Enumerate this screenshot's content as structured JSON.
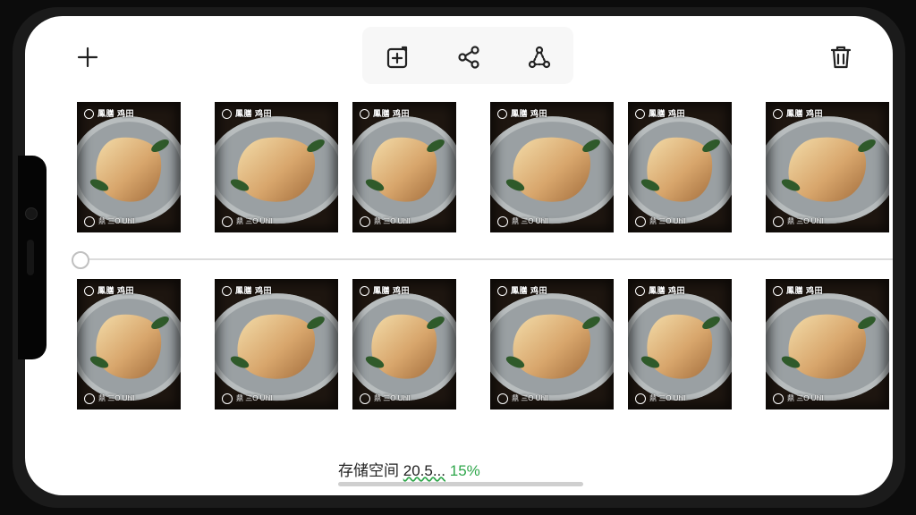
{
  "toolbar": {
    "add_icon": "plus-icon",
    "add_to_album_icon": "add-photo-icon",
    "share_icon": "share-icon",
    "scan_icon": "scan-icon",
    "delete_icon": "trash-icon"
  },
  "rows": [
    {
      "items": [
        {
          "top_caption": "鳳膳 鸡田",
          "bottom_caption": "鼎 三O Uhll"
        },
        {
          "top_caption": "鳳膳 鸡田",
          "bottom_caption": "鼎 三O Uhll"
        },
        {
          "top_caption": "鳳膳 鸡田",
          "bottom_caption": "鼎 三O Uhll"
        },
        {
          "top_caption": "鳳膳 鸡田",
          "bottom_caption": "鼎 三O Uhll"
        },
        {
          "top_caption": "鳳膳 鸡田",
          "bottom_caption": "鼎 三O Uhll"
        },
        {
          "top_caption": "鳳膳 鸡田",
          "bottom_caption": "鼎 三O Uhll"
        }
      ]
    },
    {
      "items": [
        {
          "top_caption": "鳳膳 鸡田",
          "bottom_caption": "鼎 三O Uhll"
        },
        {
          "top_caption": "鳳膳 鸡田",
          "bottom_caption": "鼎 三O Uhll"
        },
        {
          "top_caption": "鳳膳 鸡田",
          "bottom_caption": "鼎 三O Uhll"
        },
        {
          "top_caption": "鳳膳 鸡田",
          "bottom_caption": "鼎 三O Uhll"
        },
        {
          "top_caption": "鳳膳 鸡田",
          "bottom_caption": "鼎 三O Uhll"
        },
        {
          "top_caption": "鳳膳 鸡田",
          "bottom_caption": "鼎 三O Uhll"
        }
      ]
    }
  ],
  "storage": {
    "label": "存储空间",
    "value": "20.5...",
    "percent": "15%"
  },
  "colors": {
    "accent_green": "#2ea64a",
    "screen_bg": "#ffffff",
    "frame": "#1b1b1b"
  }
}
